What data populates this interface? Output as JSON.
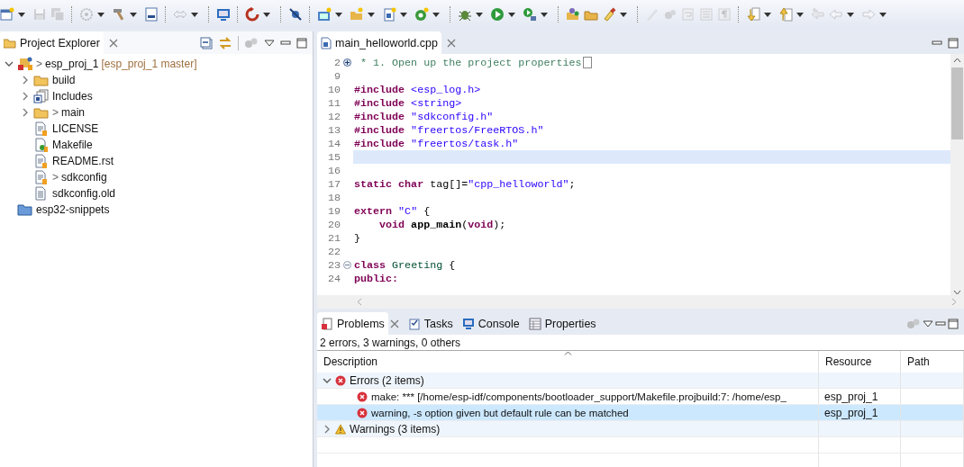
{
  "toolbar": [
    {
      "kind": "button",
      "disabled": false,
      "dropdown": true
    },
    {
      "kind": "button",
      "disabled": true,
      "dropdown": false
    },
    {
      "kind": "button",
      "disabled": true,
      "dropdown": false
    },
    {
      "kind": "separator"
    },
    {
      "kind": "button",
      "disabled": true,
      "dropdown": true
    },
    {
      "kind": "button",
      "disabled": false,
      "dropdown": true
    },
    {
      "kind": "button",
      "disabled": false,
      "dropdown": false
    },
    {
      "kind": "separator"
    },
    {
      "kind": "button",
      "disabled": true,
      "dropdown": true
    },
    {
      "kind": "separator"
    },
    {
      "kind": "button",
      "disabled": false,
      "dropdown": false
    },
    {
      "kind": "separator"
    },
    {
      "kind": "button",
      "disabled": false,
      "dropdown": true
    },
    {
      "kind": "separator"
    },
    {
      "kind": "button",
      "disabled": false,
      "dropdown": false
    },
    {
      "kind": "separator"
    },
    {
      "kind": "button",
      "disabled": false,
      "dropdown": true
    },
    {
      "kind": "button",
      "disabled": false,
      "dropdown": true
    },
    {
      "kind": "button",
      "disabled": false,
      "dropdown": true
    },
    {
      "kind": "button",
      "disabled": false,
      "dropdown": true
    },
    {
      "kind": "separator"
    },
    {
      "kind": "button",
      "disabled": false,
      "dropdown": true
    },
    {
      "kind": "button",
      "disabled": false,
      "dropdown": true
    },
    {
      "kind": "button",
      "disabled": false,
      "dropdown": true
    },
    {
      "kind": "separator"
    },
    {
      "kind": "button",
      "disabled": false,
      "dropdown": false
    },
    {
      "kind": "button",
      "disabled": false,
      "dropdown": false
    },
    {
      "kind": "button",
      "disabled": false,
      "dropdown": true
    },
    {
      "kind": "separator"
    },
    {
      "kind": "button",
      "disabled": true,
      "dropdown": false
    },
    {
      "kind": "button",
      "disabled": true,
      "dropdown": false
    },
    {
      "kind": "button",
      "disabled": true,
      "dropdown": false
    },
    {
      "kind": "button",
      "disabled": true,
      "dropdown": false
    },
    {
      "kind": "button",
      "disabled": true,
      "dropdown": false
    },
    {
      "kind": "separator"
    },
    {
      "kind": "button",
      "disabled": false,
      "dropdown": true
    },
    {
      "kind": "button",
      "disabled": false,
      "dropdown": true
    },
    {
      "kind": "button",
      "disabled": true,
      "dropdown": false
    },
    {
      "kind": "button",
      "disabled": true,
      "dropdown": true
    },
    {
      "kind": "button",
      "disabled": true,
      "dropdown": true
    }
  ],
  "project_explorer": {
    "title": "Project Explorer",
    "tree": [
      {
        "kind": "project",
        "prefix": ">",
        "label": "esp_proj_1",
        "decoration": "[esp_proj_1 master]",
        "expanded": true,
        "children": [
          {
            "kind": "folder",
            "label": "build",
            "expanded": false
          },
          {
            "kind": "includes",
            "label": "Includes",
            "expanded": false
          },
          {
            "kind": "folder",
            "prefix": ">",
            "label": "main",
            "expanded": false
          },
          {
            "kind": "file",
            "label": "LICENSE"
          },
          {
            "kind": "makefile",
            "label": "Makefile"
          },
          {
            "kind": "file",
            "label": "README.rst"
          },
          {
            "kind": "file",
            "prefix": ">",
            "label": "sdkconfig"
          },
          {
            "kind": "plain-file",
            "label": "sdkconfig.old"
          }
        ]
      },
      {
        "kind": "closed-project",
        "label": "esp32-snippets"
      }
    ]
  },
  "editor": {
    "tab": "main_helloworld.cpp",
    "lines": [
      {
        "number": "2",
        "collapsed": true,
        "current": false,
        "tokens": [
          {
            "kind": "comment",
            "text": " * 1. Open up the project properties"
          }
        ]
      },
      {
        "number": "9",
        "current": false
      },
      {
        "number": "10",
        "current": false,
        "tokens": [
          {
            "kind": "kw",
            "text": "#include"
          },
          {
            "kind": "str",
            "text": " <esp_log.h>"
          }
        ]
      },
      {
        "number": "11",
        "current": false,
        "tokens": [
          {
            "kind": "kw",
            "text": "#include"
          },
          {
            "kind": "str",
            "text": " <string>"
          }
        ]
      },
      {
        "number": "12",
        "current": false,
        "tokens": [
          {
            "kind": "kw",
            "text": "#include"
          },
          {
            "kind": "str",
            "text": " \"sdkconfig.h\""
          }
        ]
      },
      {
        "number": "13",
        "current": false,
        "tokens": [
          {
            "kind": "kw",
            "text": "#include"
          },
          {
            "kind": "str",
            "text": " \"freertos/FreeRTOS.h\""
          }
        ]
      },
      {
        "number": "14",
        "current": false,
        "tokens": [
          {
            "kind": "kw",
            "text": "#include"
          },
          {
            "kind": "str",
            "text": " \"freertos/task.h\""
          }
        ]
      },
      {
        "number": "15",
        "current": true
      },
      {
        "number": "16",
        "current": false
      },
      {
        "number": "17",
        "current": false,
        "tokens": [
          {
            "kind": "kw",
            "text": "static char"
          },
          {
            "kind": "plain",
            "text": " tag[]="
          },
          {
            "kind": "str",
            "text": "\"cpp_helloworld\""
          },
          {
            "kind": "plain",
            "text": ";"
          }
        ]
      },
      {
        "number": "18",
        "current": false
      },
      {
        "number": "19",
        "current": false,
        "tokens": [
          {
            "kind": "kw",
            "text": "extern"
          },
          {
            "kind": "str",
            "text": " \"C\""
          },
          {
            "kind": "plain",
            "text": " {"
          }
        ]
      },
      {
        "number": "20",
        "current": false,
        "tokens": [
          {
            "kind": "kw",
            "text": "    void"
          },
          {
            "kind": "fn",
            "text": " app_main"
          },
          {
            "kind": "plain",
            "text": "("
          },
          {
            "kind": "kw",
            "text": "void"
          },
          {
            "kind": "plain",
            "text": ");"
          }
        ]
      },
      {
        "number": "21",
        "current": false,
        "tokens": [
          {
            "kind": "plain",
            "text": "}"
          }
        ]
      },
      {
        "number": "22",
        "current": false
      },
      {
        "number": "23",
        "collapsed": false,
        "current": false,
        "tokens": [
          {
            "kind": "kw",
            "text": "class"
          },
          {
            "kind": "type",
            "text": " Greeting"
          },
          {
            "kind": "plain",
            "text": " {"
          }
        ]
      },
      {
        "number": "24",
        "current": false,
        "tokens": [
          {
            "kind": "kw",
            "text": "public:"
          }
        ]
      }
    ]
  },
  "problems_view": {
    "tabs": [
      {
        "label": "Problems",
        "selected": true
      },
      {
        "label": "Tasks",
        "selected": false
      },
      {
        "label": "Console",
        "selected": false
      },
      {
        "label": "Properties",
        "selected": false
      }
    ],
    "summary": "2 errors, 3 warnings, 0 others",
    "columns": [
      "Description",
      "Resource",
      "Path"
    ],
    "groups": [
      {
        "kind": "error",
        "label": "Errors (2 items)",
        "expanded": true,
        "items": [
          {
            "kind": "error",
            "description": "make: *** [/home/esp-idf/components/bootloader_support/Makefile.projbuild:7: /home/esp_",
            "resource": "esp_proj_1",
            "selected": false
          },
          {
            "kind": "error",
            "description": "warning, -s option given but default rule can be matched",
            "resource": "esp_proj_1",
            "selected": true
          }
        ]
      },
      {
        "kind": "warning",
        "label": "Warnings (3 items)",
        "expanded": false
      }
    ]
  }
}
